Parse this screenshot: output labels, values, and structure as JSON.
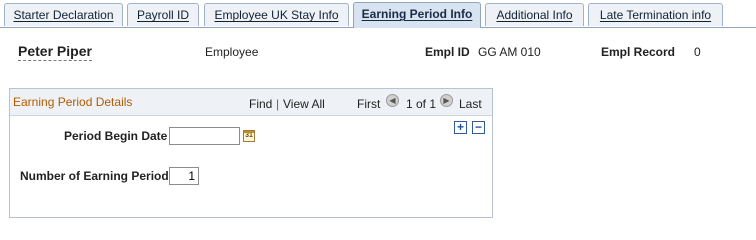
{
  "tabs": [
    {
      "label": "Starter Declaration",
      "active": false
    },
    {
      "label": "Payroll ID",
      "active": false
    },
    {
      "label": "Employee UK Stay Info",
      "active": false
    },
    {
      "label": "Earning Period Info",
      "active": true
    },
    {
      "label": "Additional Info",
      "active": false
    },
    {
      "label": "Late Termination info",
      "active": false
    }
  ],
  "header": {
    "name": "Peter Piper",
    "role": "Employee",
    "empl_id_label": "Empl ID",
    "empl_id_value": "GG AM 010",
    "empl_record_label": "Empl Record",
    "empl_record_value": "0"
  },
  "grid": {
    "title": "Earning Period Details",
    "find": "Find",
    "separator": "|",
    "view_all": "View All",
    "first": "First",
    "prev_icon": "previous-arrow-icon",
    "range": "1 of 1",
    "next_icon": "next-arrow-icon",
    "last": "Last",
    "add_icon": "+",
    "delete_icon": "−",
    "fields": {
      "period_begin_label": "Period Begin Date",
      "period_begin_value": "",
      "calendar_icon": "31",
      "num_period_label": "Number of Earning Period",
      "num_period_value": "1"
    }
  }
}
